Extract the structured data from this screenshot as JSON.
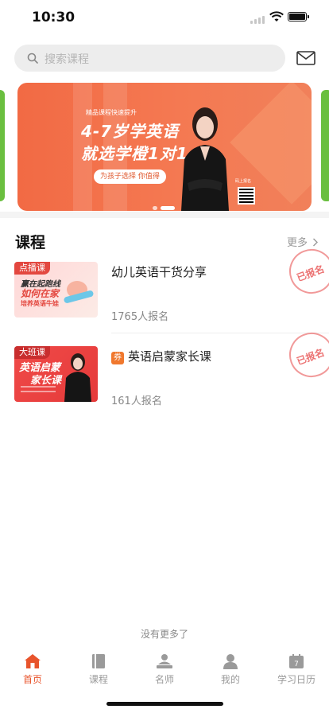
{
  "status": {
    "time": "10:30"
  },
  "search": {
    "placeholder": "搜索课程"
  },
  "banner": {
    "label": "精品课程快速提升",
    "headline_1": "4-7岁学英语",
    "headline_2": "就选学橙1对1",
    "pill": "为孩子选择 你值得",
    "qr_caption": "码上报名"
  },
  "section": {
    "title": "课程",
    "more": "更多"
  },
  "courses": [
    {
      "tag": "点播课",
      "thumb_line1": "赢在起跑线",
      "thumb_line2": "如何在家",
      "thumb_line3": "培养英语牛娃",
      "title": "幼儿英语干货分享",
      "count": "1765人报名",
      "stamp": "已报名"
    },
    {
      "tag": "大班课",
      "thumb_line1": "英语启蒙",
      "thumb_line2": "家长课",
      "coupon": "券",
      "title": "英语启蒙家长课",
      "count": "161人报名",
      "stamp": "已报名"
    }
  ],
  "footer": {
    "no_more": "没有更多了"
  },
  "tabs": [
    {
      "label": "首页",
      "icon": "home-icon",
      "active": true
    },
    {
      "label": "课程",
      "icon": "book-icon"
    },
    {
      "label": "名师",
      "icon": "teacher-icon"
    },
    {
      "label": "我的",
      "icon": "person-icon"
    },
    {
      "label": "学习日历",
      "icon": "calendar-icon",
      "calendar_day": "7"
    }
  ],
  "colors": {
    "accent": "#e8542c",
    "banner": "#f26a44",
    "green_card": "#6abf3f",
    "tag_red": "#e3473f"
  }
}
